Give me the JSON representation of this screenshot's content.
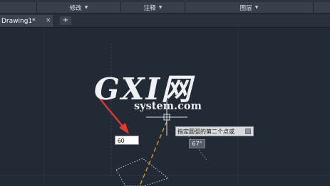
{
  "ribbon": {
    "panels": [
      {
        "label": "修改"
      },
      {
        "label": "注释"
      },
      {
        "label": "图层"
      }
    ]
  },
  "tabs": {
    "active_label": "Drawing1*",
    "close_glyph": "×",
    "new_tab_glyph": "+"
  },
  "drawing": {
    "dynamic_input_value": "60",
    "prompt_text": "指定圆弧的第二个点或",
    "angle_readout": "67°"
  },
  "watermark": {
    "logo": "GXI网",
    "site": "system.com"
  },
  "colors": {
    "canvas": "#222a36",
    "arrow": "#e23a2e",
    "arc_preview": "#e0a030",
    "crosshair": "#d9dde2"
  },
  "icons": {
    "caret": "chevron-down-icon",
    "close": "close-icon",
    "add": "plus-icon",
    "tooltip": "tooltip-keyboard-icon",
    "arrow": "red-arrow-annotation-icon"
  }
}
